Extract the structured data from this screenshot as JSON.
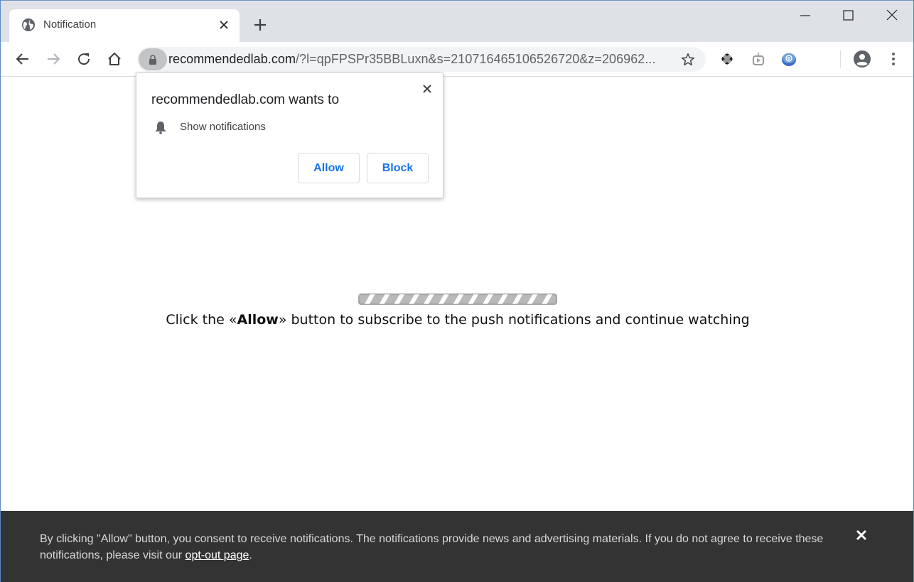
{
  "browser": {
    "tab": {
      "title": "Notification",
      "icon": "globe-icon"
    },
    "window_controls": [
      "minimize-icon",
      "maximize-icon",
      "close-icon"
    ],
    "address": {
      "host": "recommendedlab.com",
      "path": "/?l=qpFPSPr35BBLuxn&s=210716465106526720&z=206962...",
      "secure": true
    },
    "extensions": [
      "diamond-extension-icon",
      "tv-extension-icon",
      "mail-extension-icon"
    ]
  },
  "permission_popup": {
    "title": "recommendedlab.com wants to",
    "permission": "Show notifications",
    "allow_label": "Allow",
    "block_label": "Block"
  },
  "page": {
    "headline_prefix": "Click the «",
    "headline_bold": "Allow",
    "headline_suffix": "» button to subscribe to the push notifications and continue watching"
  },
  "consent_bar": {
    "text": "By clicking \"Allow\" button, you consent to receive notifications. The notifications provide news and advertising materials. If you do not agree to receive these notifications, please visit our ",
    "link_label": "opt-out page",
    "trailing": "."
  }
}
